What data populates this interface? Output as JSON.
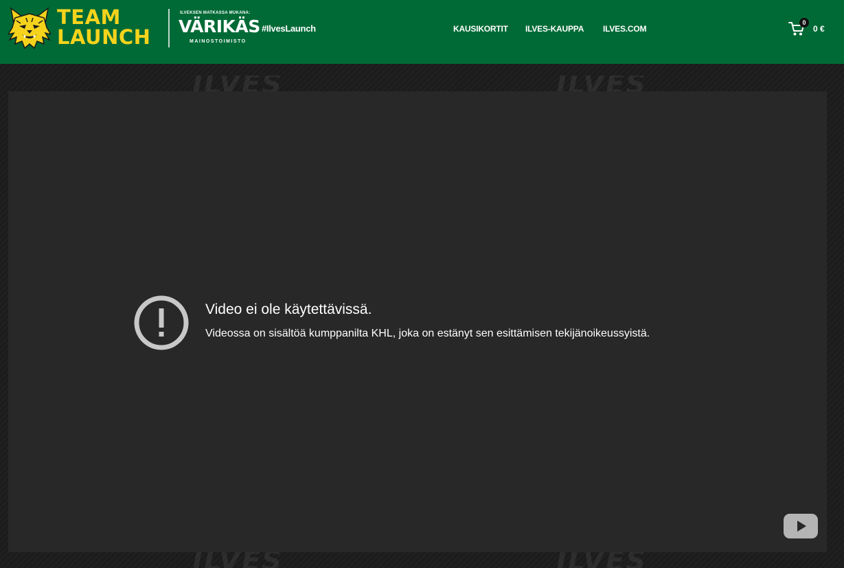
{
  "header": {
    "brand_line1": "TEAM",
    "brand_line2": "LAUNCH",
    "partner_kicker": "ILVEKSEN MATKASSA MUKANA:",
    "partner_name": "VÄRIKÄS",
    "partner_sub": "MAINOSTOIMISTO",
    "hashtag": "#IlvesLaunch",
    "nav": [
      "KAUSIKORTIT",
      "ILVES-KAUPPA",
      "ILVES.COM"
    ],
    "cart_count": "0",
    "cart_total": "0 €"
  },
  "background": {
    "watermark_text": "ILVES"
  },
  "player": {
    "error_title": "Video ei ole käytettävissä.",
    "error_message": "Videossa on sisältöä kumppanilta KHL, joka on estänyt sen esittämisen tekijänoikeussyistä."
  },
  "colors": {
    "header_bg": "#006a36",
    "brand_yellow": "#f5d31c",
    "page_bg": "#1c1c1c",
    "player_bg": "#282828",
    "icon_gray": "#c8c8c8"
  },
  "icons": [
    "ilves-lynx-logo-icon",
    "cart-icon",
    "alert-circle-icon",
    "youtube-play-icon"
  ]
}
